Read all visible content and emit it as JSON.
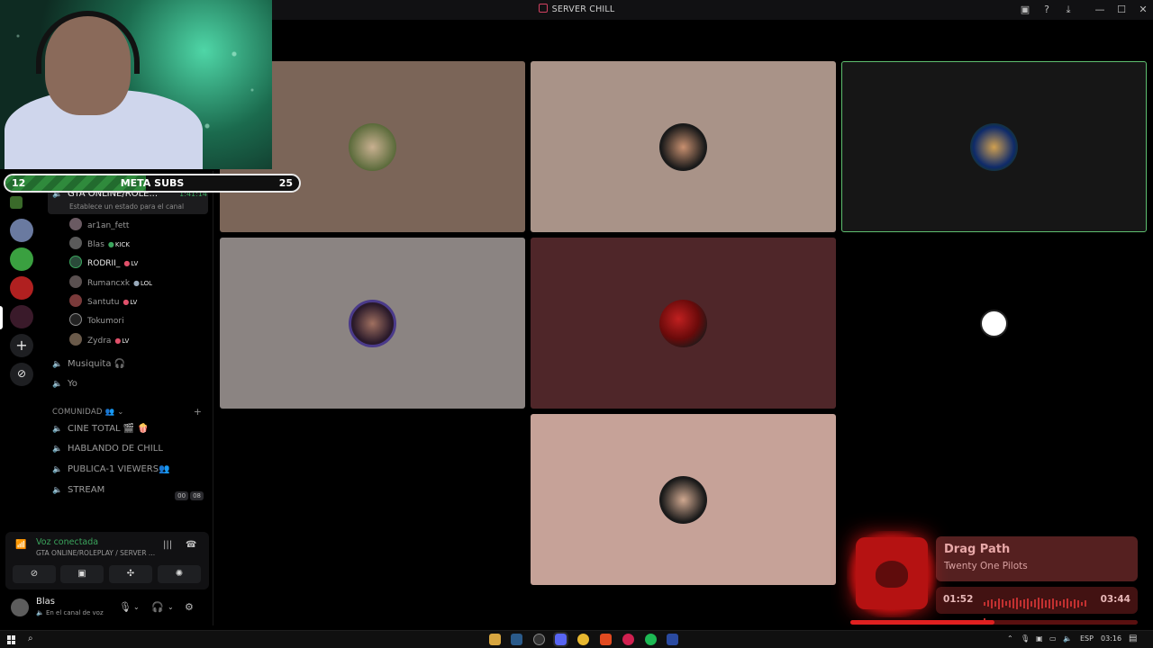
{
  "window": {
    "title": "SERVER CHILL"
  },
  "meta_subs": {
    "current": "12",
    "label": "META SUBS",
    "goal": "25",
    "progress": 0.48
  },
  "channels": {
    "active": {
      "name": "GTA ONLINE/ROLE...",
      "time": "1:41:14",
      "status": "Establece un estado para el canal"
    },
    "members": [
      {
        "name": "ar1an_fett",
        "badge": ""
      },
      {
        "name": "Blas",
        "badge": "KICK"
      },
      {
        "name": "RODRII_",
        "badge": "LV"
      },
      {
        "name": "Rumancxk",
        "badge": "LOL"
      },
      {
        "name": "Santutu",
        "badge": "LV"
      },
      {
        "name": "Tokumori",
        "badge": ""
      },
      {
        "name": "Zydra",
        "badge": "LV"
      }
    ],
    "voice_channels": [
      {
        "name": "Musiquita 🎧"
      },
      {
        "name": "Yo"
      }
    ],
    "category": "COMUNIDAD 👥",
    "community_channels": [
      {
        "name": "CINE TOTAL 🎬 🍿"
      },
      {
        "name": "HABLANDO DE CHILL"
      },
      {
        "name": "PUBLICA-1 VIEWERS👥"
      },
      {
        "name": "STREAM"
      }
    ],
    "stream_tags": [
      "00",
      "08"
    ]
  },
  "voice": {
    "status": "Voz conectada",
    "channel": "GTA ONLINE/ROLEPLAY / SERVER ..."
  },
  "user": {
    "name": "Blas",
    "status": "En el canal de voz"
  },
  "music": {
    "title": "Drag Path",
    "artist": "Twenty One Pilots",
    "elapsed": "01:52",
    "duration": "03:44",
    "progress": 0.5
  },
  "taskbar": {
    "lang": "ESP",
    "time": "03:16"
  },
  "colors": {
    "accent_green": "#3ba55d",
    "speaking_border": "#5fbf70",
    "music_red": "#e02020"
  }
}
